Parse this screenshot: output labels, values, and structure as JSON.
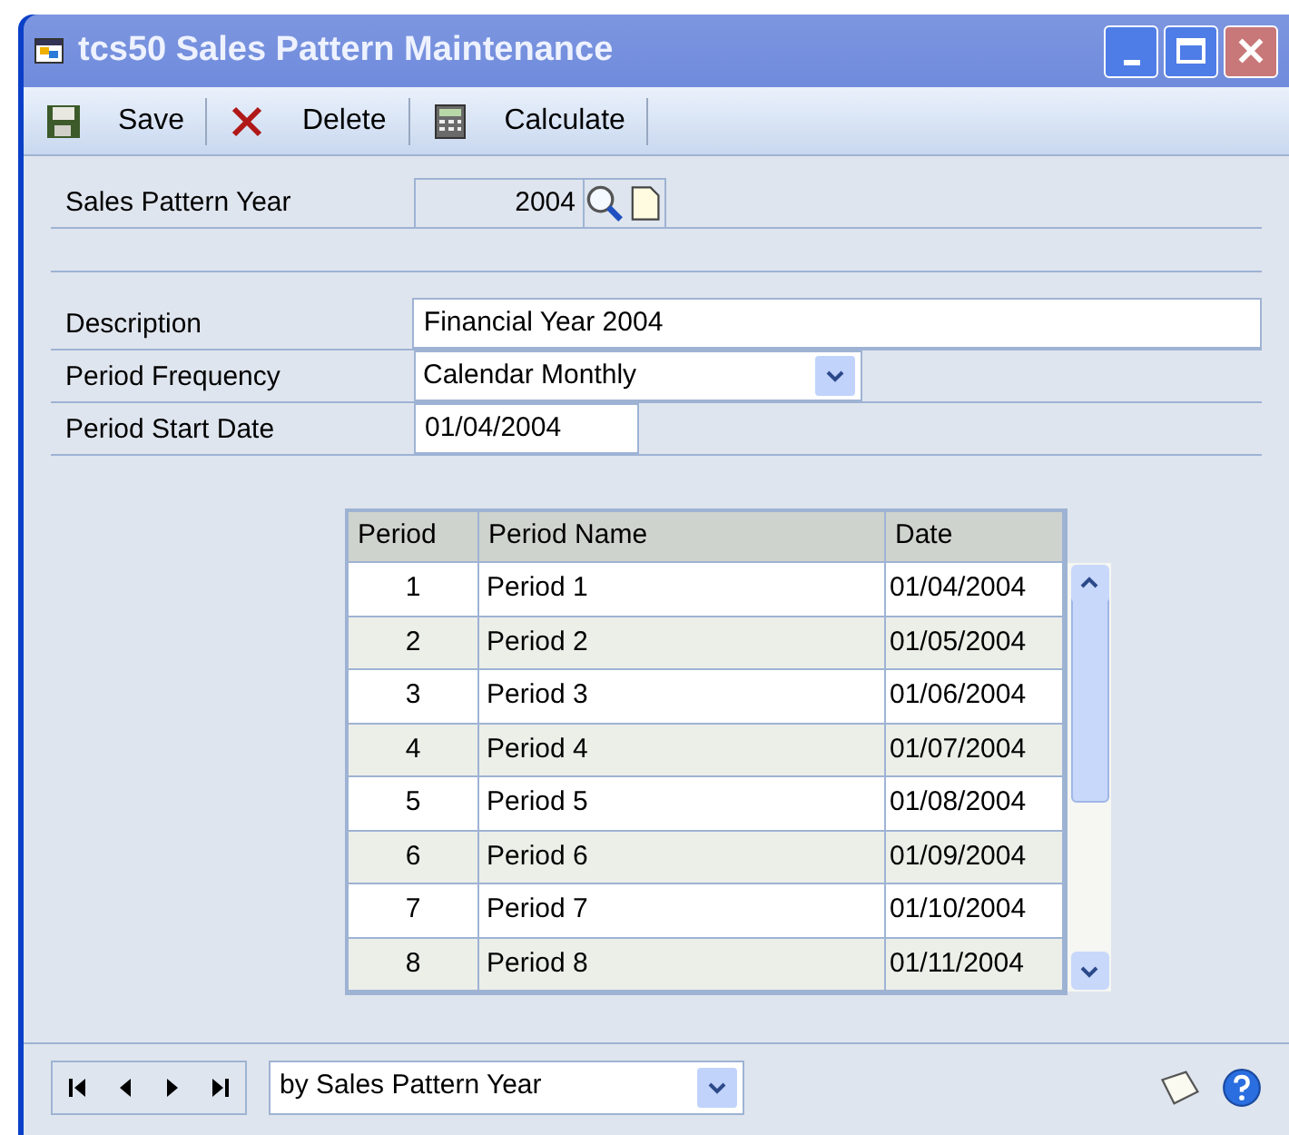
{
  "window": {
    "title": "tcs50 Sales Pattern Maintenance"
  },
  "toolbar": [
    {
      "label": "Save",
      "kind": "save"
    },
    {
      "label": "Delete",
      "kind": "delete"
    },
    {
      "label": "Calculate",
      "kind": "calculate"
    }
  ],
  "header_field": {
    "label": "Sales Pattern Year",
    "value": "2004"
  },
  "fields": [
    {
      "label": "Description",
      "value": "Financial Year 2004",
      "kind": "text"
    },
    {
      "label": "Period Frequency",
      "value": "Calendar Monthly",
      "kind": "dropdown"
    },
    {
      "label": "Period Start Date",
      "value": "01/04/2004",
      "kind": "date"
    }
  ],
  "table": {
    "columns": [
      "Period",
      "Period Name",
      "Date"
    ],
    "rows": [
      [
        "1",
        "Period 1",
        "01/04/2004"
      ],
      [
        "2",
        "Period 2",
        "01/05/2004"
      ],
      [
        "3",
        "Period 3",
        "01/06/2004"
      ],
      [
        "4",
        "Period 4",
        "01/07/2004"
      ],
      [
        "5",
        "Period 5",
        "01/08/2004"
      ],
      [
        "6",
        "Period 6",
        "01/09/2004"
      ],
      [
        "7",
        "Period 7",
        "01/10/2004"
      ],
      [
        "8",
        "Period 8",
        "01/11/2004"
      ]
    ]
  },
  "footer": {
    "sort": "by Sales Pattern Year"
  }
}
